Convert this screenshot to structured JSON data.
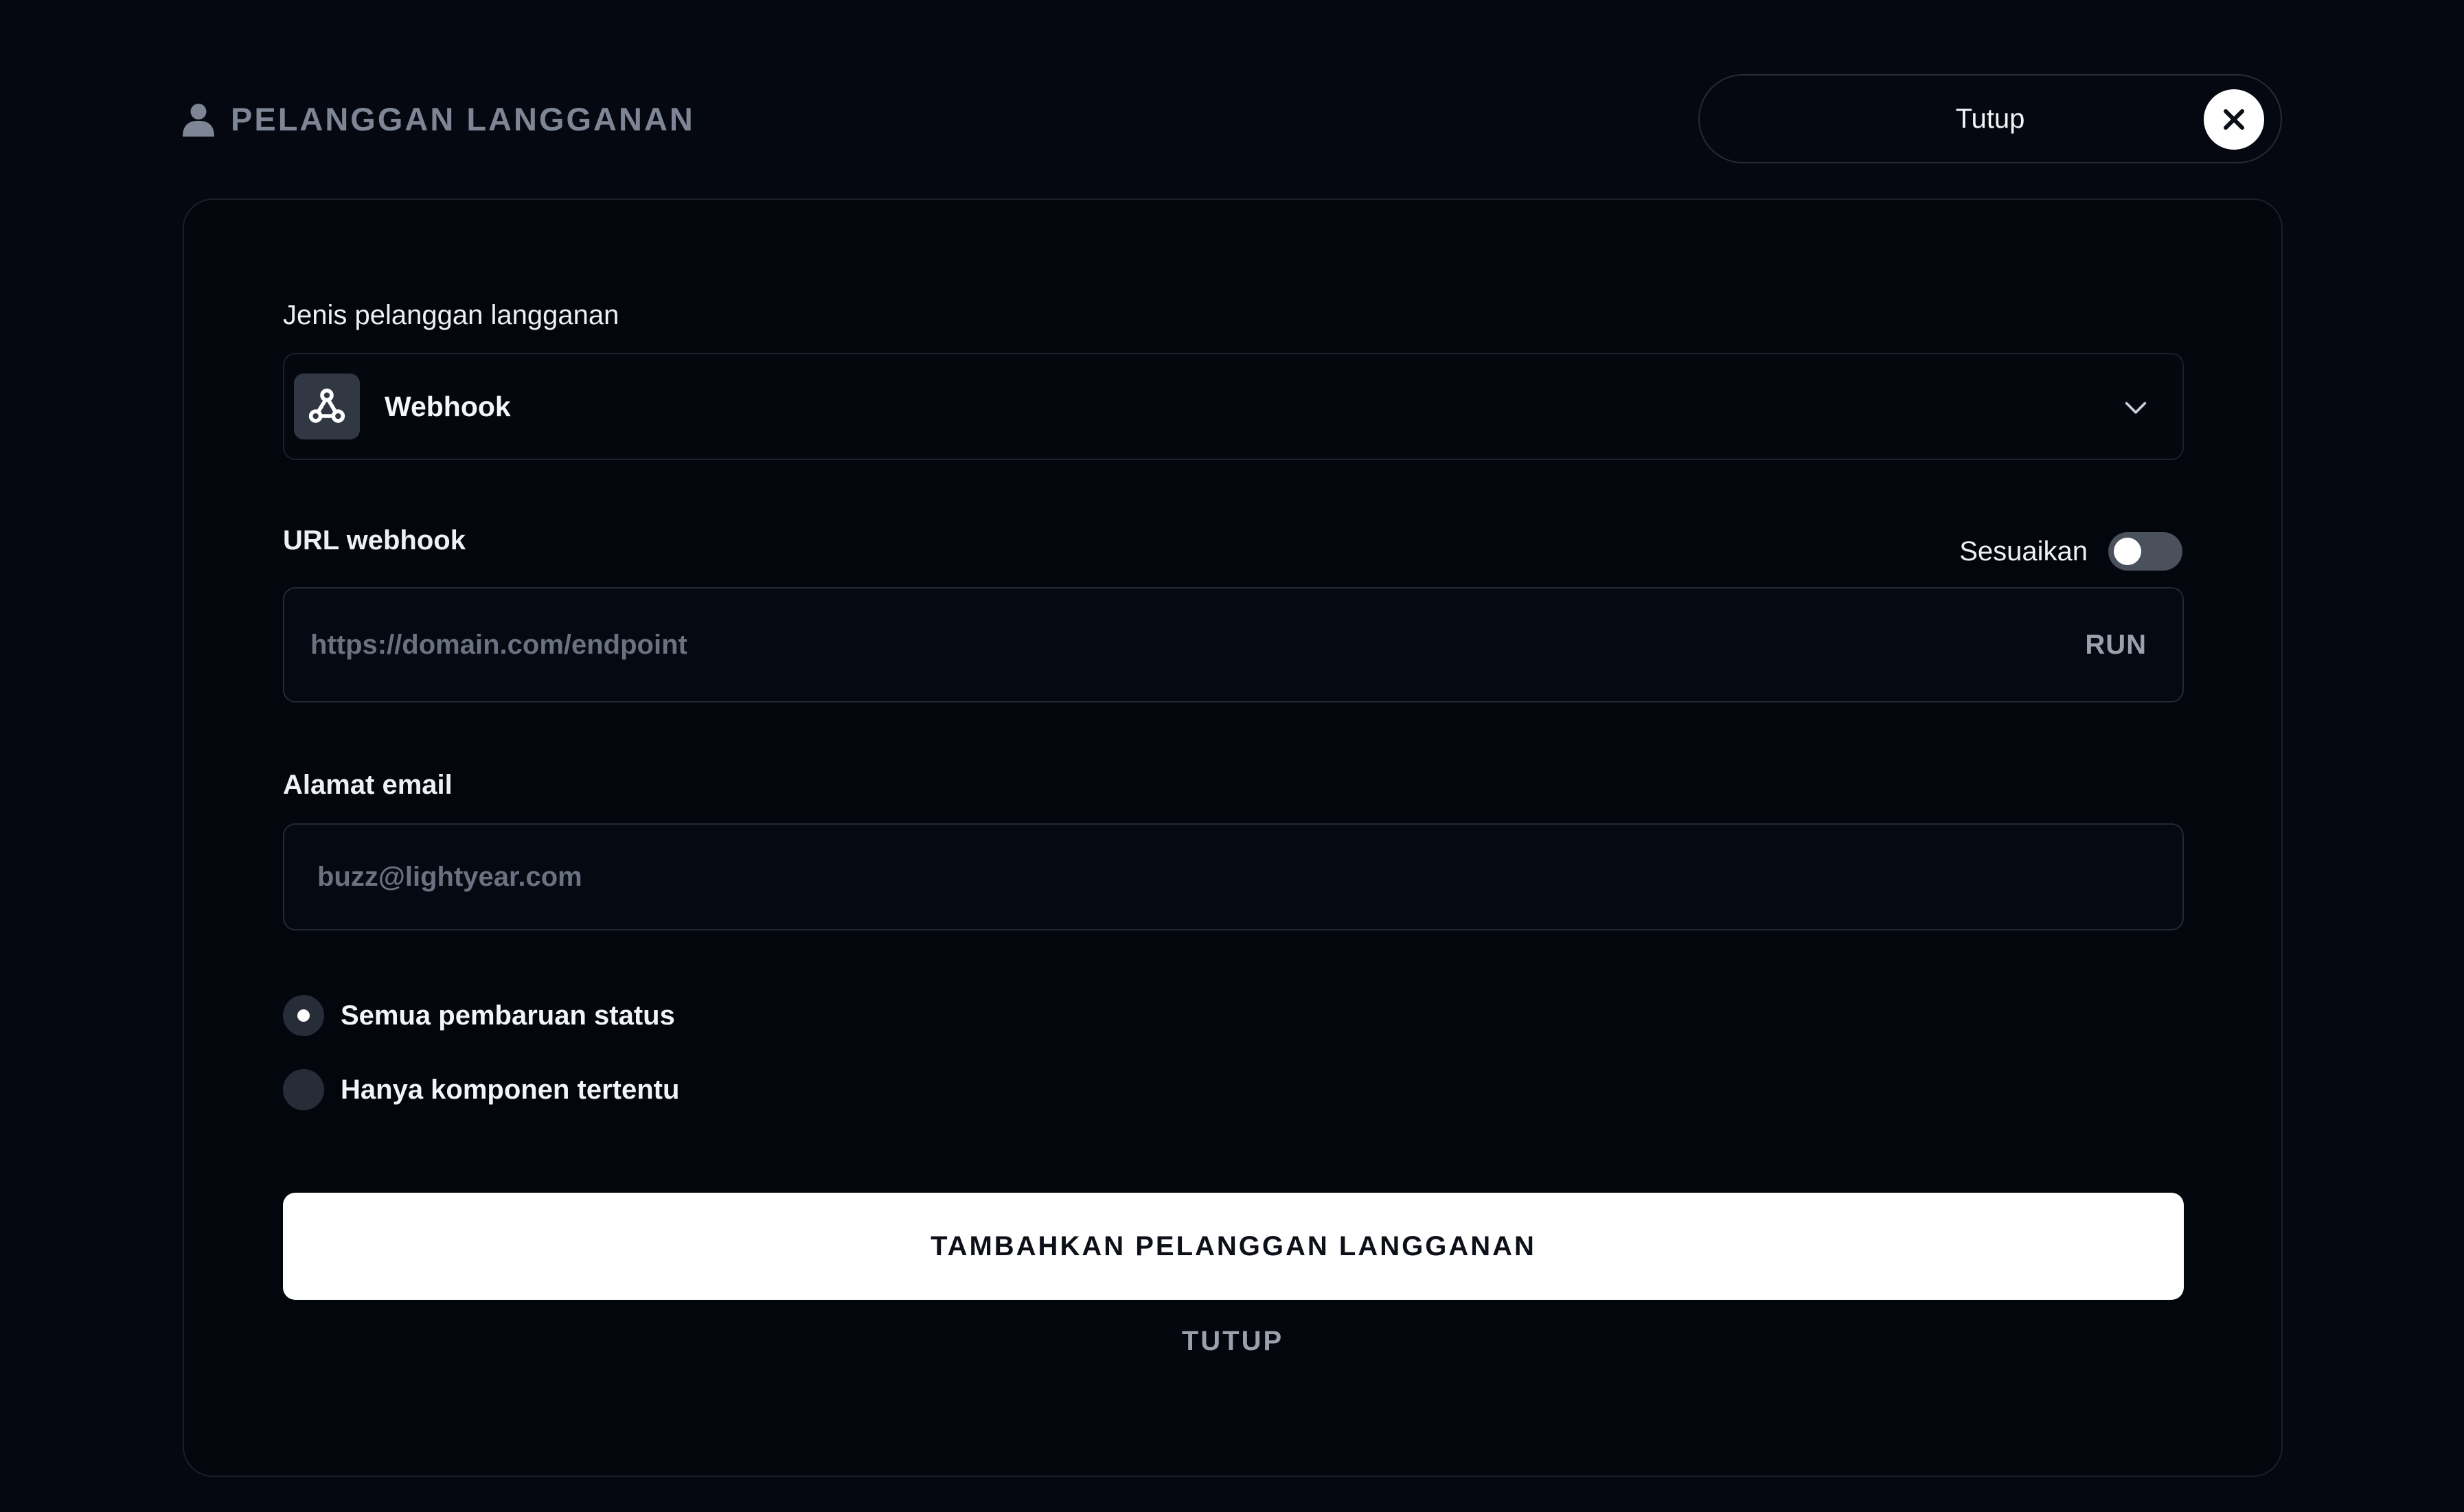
{
  "header": {
    "title": "PELANGGAN LANGGANAN",
    "title_icon": "person-icon",
    "close_label": "Tutup",
    "close_icon": "close-icon"
  },
  "form": {
    "type_field": {
      "label": "Jenis pelanggan langganan",
      "selected_value": "Webhook",
      "selected_icon": "webhook-icon",
      "dropdown_icon": "chevron-down-icon"
    },
    "url_field": {
      "label": "URL webhook",
      "customize_label": "Sesuaikan",
      "customize_enabled": false,
      "value": "",
      "placeholder": "https://domain.com/endpoint",
      "run_label": "RUN"
    },
    "email_field": {
      "label": "Alamat email",
      "value": "",
      "placeholder": "buzz@lightyear.com"
    },
    "scope_options": [
      {
        "label": "Semua pembaruan status",
        "selected": true
      },
      {
        "label": "Hanya komponen tertentu",
        "selected": false
      }
    ],
    "submit_label": "TAMBAHKAN PELANGGAN LANGGANAN",
    "cancel_label": "TUTUP"
  },
  "colors": {
    "background": "#050810",
    "card_border": "#1a1f2a",
    "muted_text": "#7e8594",
    "primary_button": "#ffffff",
    "toggle_off": "#4a505c"
  }
}
